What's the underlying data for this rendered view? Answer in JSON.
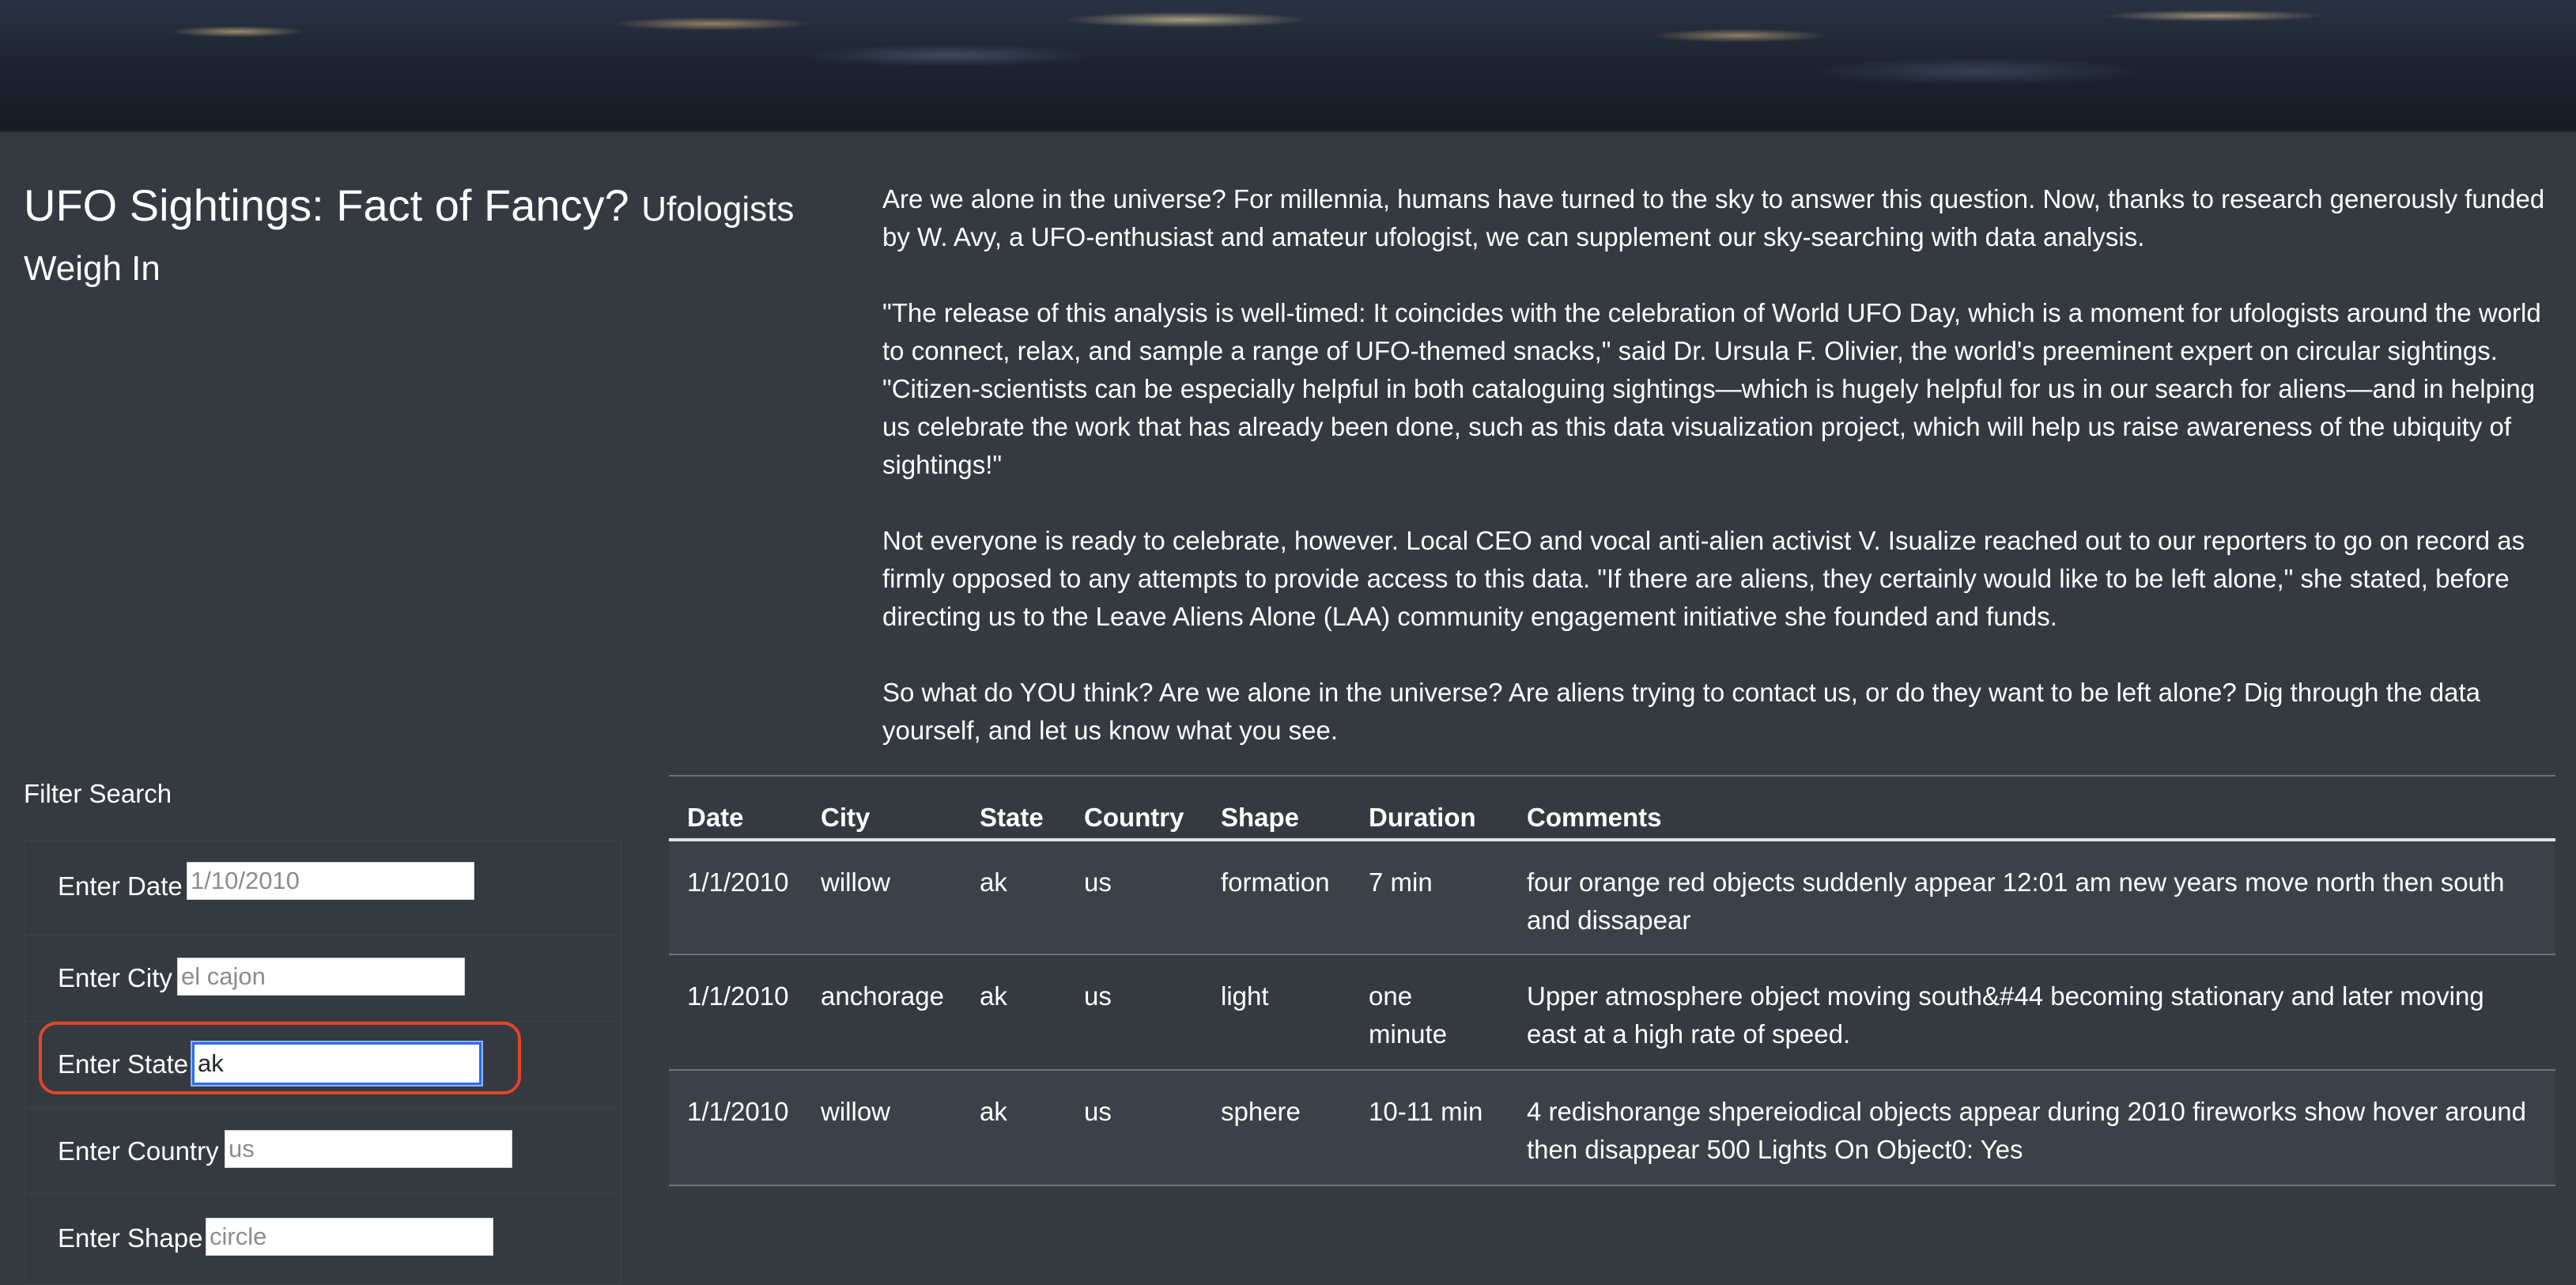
{
  "header": {
    "title_main": "UFO Sightings: Fact of Fancy?",
    "title_sub": "Ufologists Weigh In"
  },
  "article": {
    "paragraphs": [
      "Are we alone in the universe? For millennia, humans have turned to the sky to answer this question. Now, thanks to research generously funded by W. Avy, a UFO-enthusiast and amateur ufologist, we can supplement our sky-searching with data analysis.",
      "\"The release of this analysis is well-timed: It coincides with the celebration of World UFO Day, which is a moment for ufologists around the world to connect, relax, and sample a range of UFO-themed snacks,\" said Dr. Ursula F. Olivier, the world's preeminent expert on circular sightings. \"Citizen-scientists can be especially helpful in both cataloguing sightings—which is hugely helpful for us in our search for aliens—and in helping us celebrate the work that has already been done, such as this data visualization project, which will help us raise awareness of the ubiquity of sightings!\"",
      "Not everyone is ready to celebrate, however. Local CEO and vocal anti-alien activist V. Isualize reached out to our reporters to go on record as firmly opposed to any attempts to provide access to this data. \"If there are aliens, they certainly would like to be left alone,\" she stated, before directing us to the Leave Aliens Alone (LAA) community engagement initiative she founded and funds.",
      "So what do YOU think? Are we alone in the universe? Are aliens trying to contact us, or do they want to be left alone? Dig through the data yourself, and let us know what you see."
    ]
  },
  "filters": {
    "heading": "Filter Search",
    "items": [
      {
        "label": "Enter Date",
        "placeholder": "1/10/2010",
        "value": ""
      },
      {
        "label": "Enter City",
        "placeholder": "el cajon",
        "value": ""
      },
      {
        "label": "Enter State",
        "placeholder": "",
        "value": "ak"
      },
      {
        "label": "Enter Country",
        "placeholder": "us",
        "value": ""
      },
      {
        "label": "Enter Shape",
        "placeholder": "circle",
        "value": ""
      }
    ]
  },
  "table": {
    "columns": [
      "Date",
      "City",
      "State",
      "Country",
      "Shape",
      "Duration",
      "Comments"
    ],
    "rows": [
      {
        "date": "1/1/2010",
        "city": "willow",
        "state": "ak",
        "country": "us",
        "shape": "formation",
        "duration": "7 min",
        "comments_1": "four orange red objects suddenly appear 12:01 am new years move north then south",
        "comments_2": "and dissapear"
      },
      {
        "date": "1/1/2010",
        "city": "anchorage",
        "state": "ak",
        "country": "us",
        "shape": "light",
        "duration_1": "one",
        "duration_2": "minute",
        "comments_1": "Upper atmosphere object moving south&#44 becoming stationary and later moving",
        "comments_2": "east at a high rate of speed."
      },
      {
        "date": "1/1/2010",
        "city": "willow",
        "state": "ak",
        "country": "us",
        "shape": "sphere",
        "duration": "10-11 min",
        "comments_1": "4 redishorange shpereiodical objects appear during 2010 fireworks show hover around",
        "comments_2": "then disappear 500 Lights On Object0: Yes"
      }
    ]
  }
}
